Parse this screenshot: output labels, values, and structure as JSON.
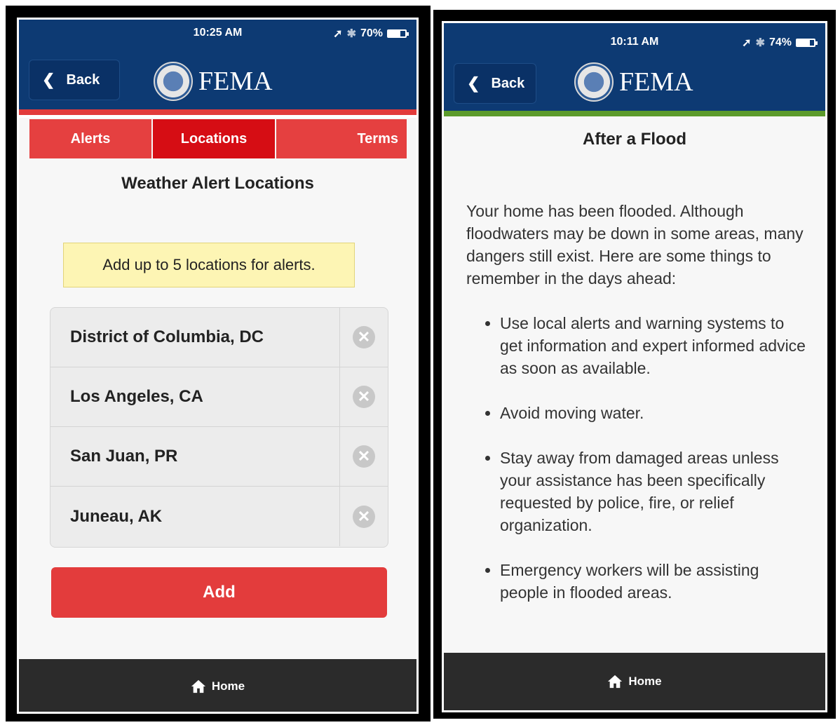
{
  "left": {
    "status": {
      "time": "10:25 AM",
      "battery": "70%",
      "battery_level": 0.7
    },
    "header": {
      "back_label": "Back",
      "logo_text": "FEMA"
    },
    "tabs": [
      {
        "label": "Alerts",
        "active": false
      },
      {
        "label": "Locations",
        "active": true
      },
      {
        "label": "Terms",
        "active": false
      }
    ],
    "title": "Weather Alert Locations",
    "notice": "Add up to 5 locations for alerts.",
    "locations": [
      "District of Columbia, DC",
      "Los Angeles, CA",
      "San Juan, PR",
      "Juneau, AK"
    ],
    "add_label": "Add",
    "footer": {
      "home_label": "Home"
    }
  },
  "right": {
    "status": {
      "time": "10:11 AM",
      "battery": "74%",
      "battery_level": 0.74
    },
    "header": {
      "back_label": "Back",
      "logo_text": "FEMA"
    },
    "title": "After a Flood",
    "intro": "Your home has been flooded. Although floodwaters may be down in some areas, many dangers still exist. Here are some things to remember in the days ahead:",
    "bullets": [
      "Use local alerts and warning systems to get information and expert informed advice as soon as available.",
      "Avoid moving water.",
      "Stay away from damaged areas unless your assistance has been specifically requested by police, fire, or relief organization.",
      "Emergency workers will be assisting people in flooded areas."
    ],
    "footer": {
      "home_label": "Home"
    }
  },
  "colors": {
    "header_blue": "#0d3a73",
    "tab_red": "#e54040",
    "tab_active_red": "#d60d14",
    "add_red": "#e33c3c",
    "notice_yellow": "#fdf5b4",
    "accent_green": "#5c9b2b",
    "footer_dark": "#2b2b2b"
  }
}
